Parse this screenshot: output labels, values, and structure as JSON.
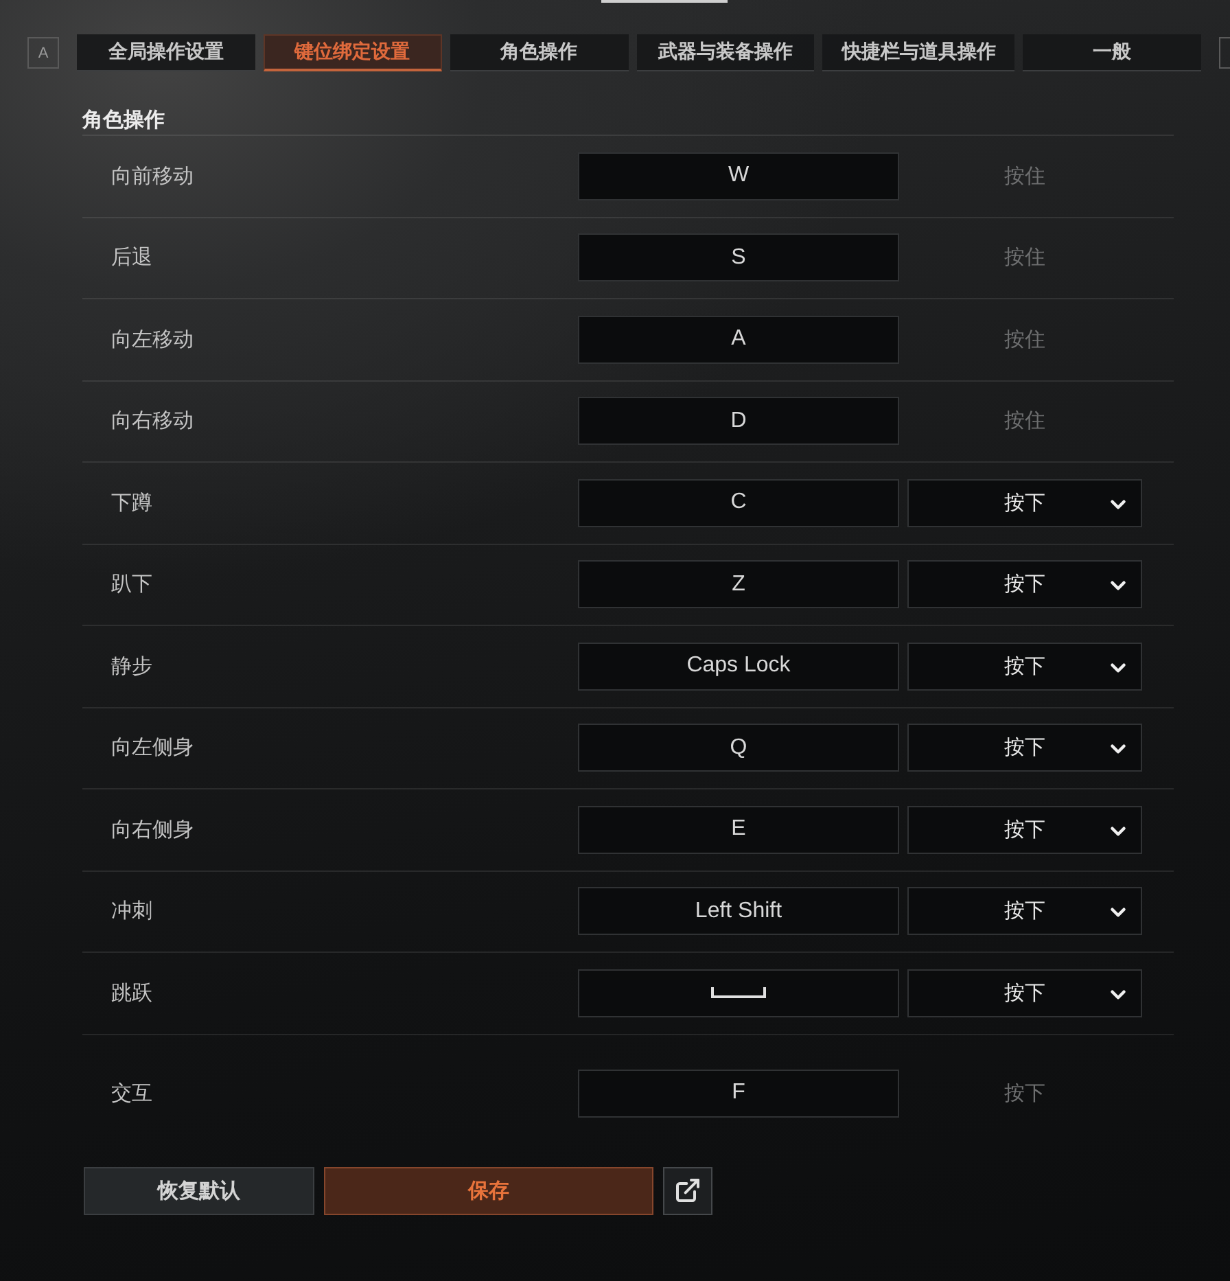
{
  "key_hint": {
    "label": "A"
  },
  "tabs": [
    {
      "label": "全局操作设置",
      "selected": false
    },
    {
      "label": "键位绑定设置",
      "selected": true
    },
    {
      "label": "角色操作",
      "selected": false
    },
    {
      "label": "武器与装备操作",
      "selected": false
    },
    {
      "label": "快捷栏与道具操作",
      "selected": false
    },
    {
      "label": "一般",
      "selected": false
    }
  ],
  "section": {
    "title": "角色操作",
    "bindings": [
      {
        "action": "向前移动",
        "key": {
          "kind": "text",
          "label": "W"
        },
        "mode": {
          "kind": "fixed",
          "label": "按住"
        }
      },
      {
        "action": "后退",
        "key": {
          "kind": "text",
          "label": "S"
        },
        "mode": {
          "kind": "fixed",
          "label": "按住"
        }
      },
      {
        "action": "向左移动",
        "key": {
          "kind": "text",
          "label": "A"
        },
        "mode": {
          "kind": "fixed",
          "label": "按住"
        }
      },
      {
        "action": "向右移动",
        "key": {
          "kind": "text",
          "label": "D"
        },
        "mode": {
          "kind": "fixed",
          "label": "按住"
        }
      },
      {
        "action": "下蹲",
        "key": {
          "kind": "text",
          "label": "C"
        },
        "mode": {
          "kind": "dropdown",
          "label": "按下"
        }
      },
      {
        "action": "趴下",
        "key": {
          "kind": "text",
          "label": "Z"
        },
        "mode": {
          "kind": "dropdown",
          "label": "按下"
        }
      },
      {
        "action": "静步",
        "key": {
          "kind": "text",
          "label": "Caps Lock"
        },
        "mode": {
          "kind": "dropdown",
          "label": "按下"
        }
      },
      {
        "action": "向左侧身",
        "key": {
          "kind": "text",
          "label": "Q"
        },
        "mode": {
          "kind": "dropdown",
          "label": "按下"
        }
      },
      {
        "action": "向右侧身",
        "key": {
          "kind": "text",
          "label": "E"
        },
        "mode": {
          "kind": "dropdown",
          "label": "按下"
        }
      },
      {
        "action": "冲刺",
        "key": {
          "kind": "text",
          "label": "Left Shift"
        },
        "mode": {
          "kind": "dropdown",
          "label": "按下"
        }
      },
      {
        "action": "跳跃",
        "key": {
          "kind": "space"
        },
        "mode": {
          "kind": "dropdown",
          "label": "按下"
        }
      },
      {
        "action": "交互",
        "key": {
          "kind": "text",
          "label": "F"
        },
        "mode": {
          "kind": "fixed",
          "label": "按下"
        }
      }
    ]
  },
  "buttons": [
    {
      "kind": "secondary",
      "label": "恢复默认"
    },
    {
      "kind": "primary",
      "label": "保存"
    },
    {
      "kind": "export"
    }
  ]
}
